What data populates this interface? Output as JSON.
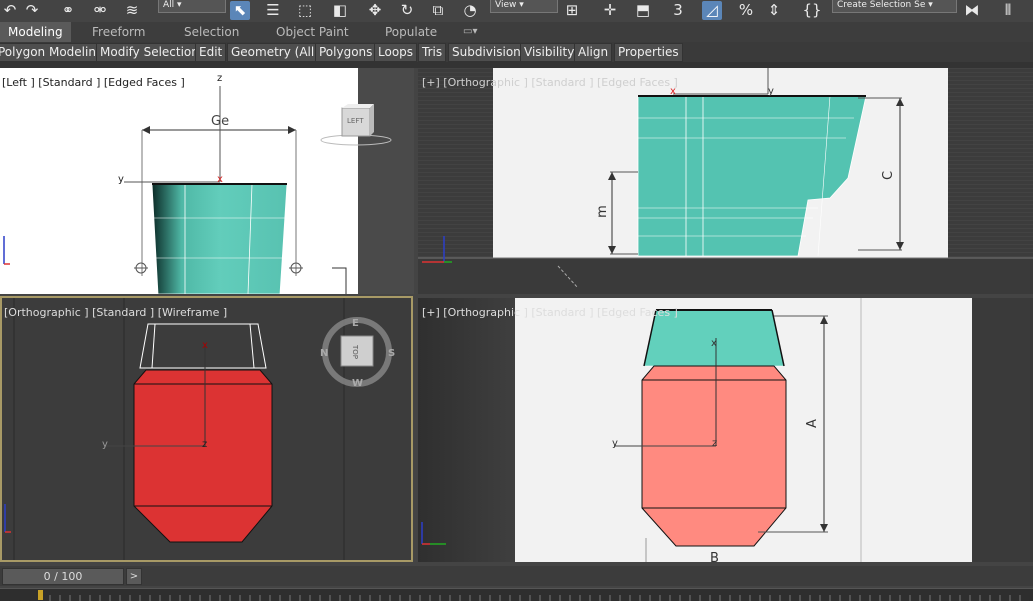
{
  "toolbar": {
    "selection_filter": "All",
    "reference_coord": "View",
    "named_selection": "Create Selection Se"
  },
  "ribbon": {
    "tabs": [
      "Modeling",
      "Freeform",
      "Selection",
      "Object Paint",
      "Populate"
    ],
    "items": [
      "Polygon Modeling",
      "Modify Selection",
      "Edit",
      "Geometry (All)",
      "Polygons",
      "Loops",
      "Tris",
      "Subdivision",
      "Visibility",
      "Align",
      "Properties"
    ]
  },
  "viewports": {
    "top_left": {
      "label": "[Left ] [Standard ] [Edged Faces ]",
      "viewcube_face": "LEFT",
      "dimension_label": "Ge",
      "axes": {
        "vertical": "z",
        "horizontal": "y",
        "origin": "x"
      }
    },
    "top_right": {
      "label": "[+] [Orthographic ] [Standard ] [Edged Faces ]",
      "dimension_labels": [
        "C",
        "m"
      ],
      "axes": {
        "origin": "x",
        "horizontal": "y"
      }
    },
    "bottom_left": {
      "label": "[Orthographic ] [Standard ] [Wireframe ]",
      "viewcube_face": "TOP",
      "compass": {
        "n": "N",
        "s": "S",
        "e": "E",
        "w": "W"
      },
      "axes": {
        "vertical": "x",
        "horizontal": "y",
        "origin": "z"
      }
    },
    "bottom_right": {
      "label": "[+] [Orthographic ] [Standard ] [Edged Faces ]",
      "dimension_labels": [
        "A",
        "B"
      ],
      "axes": {
        "vertical": "x",
        "horizontal": "y",
        "origin": "z"
      }
    }
  },
  "timeline": {
    "frame": "0 / 100",
    "next": ">"
  },
  "colors": {
    "teal": "#5ecbb8",
    "red": "#dc3333",
    "pink": "#ff8a80",
    "selection_border": "#a89a66"
  }
}
